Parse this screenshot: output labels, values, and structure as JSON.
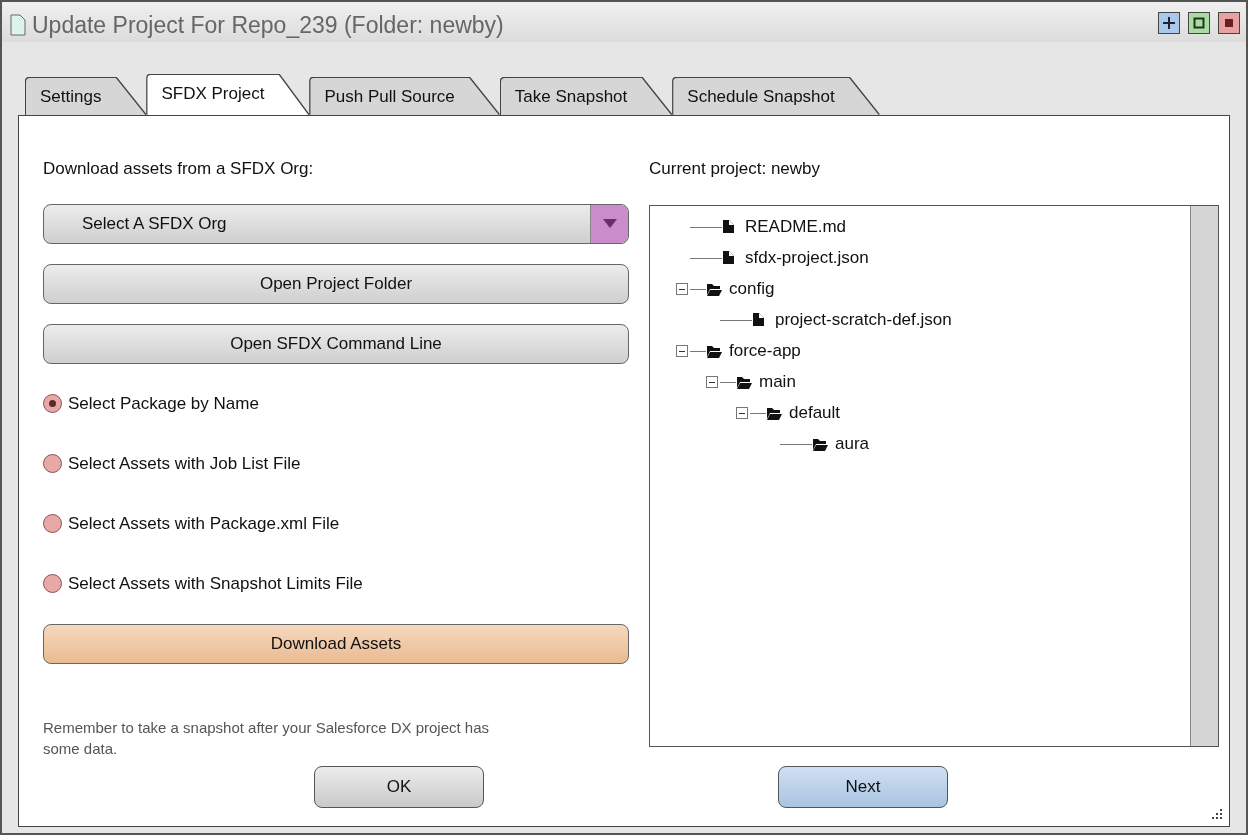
{
  "window": {
    "title": "Update Project For Repo_239 (Folder: newby)"
  },
  "tabs": [
    {
      "label": "Settings",
      "selected": false
    },
    {
      "label": "SFDX Project",
      "selected": true
    },
    {
      "label": "Push Pull Source",
      "selected": false
    },
    {
      "label": "Take Snapshot",
      "selected": false
    },
    {
      "label": "Schedule Snapshot",
      "selected": false
    }
  ],
  "left": {
    "heading": "Download assets from a SFDX Org:",
    "org_select": {
      "value": "Select A SFDX Org"
    },
    "buttons": [
      {
        "label": "Open Project Folder"
      },
      {
        "label": "Open SFDX Command Line"
      }
    ],
    "radios": [
      {
        "label": "Select Package by Name",
        "selected": true
      },
      {
        "label": "Select Assets with Job List File",
        "selected": false
      },
      {
        "label": "Select Assets with Package.xml File",
        "selected": false
      },
      {
        "label": "Select Assets with Snapshot Limits File",
        "selected": false
      }
    ],
    "action": {
      "label": "Download Assets",
      "kind": "primary"
    },
    "note": "Remember to take a snapshot after your Salesforce DX project has some data."
  },
  "right": {
    "heading": "Current project: newby",
    "tree": [
      {
        "label": "README.md",
        "kind": "file"
      },
      {
        "label": "sfdx-project.json",
        "kind": "file"
      },
      {
        "label": "config",
        "kind": "folder",
        "expanded": true,
        "children": [
          {
            "label": "project-scratch-def.json",
            "kind": "file"
          }
        ]
      },
      {
        "label": "force-app",
        "kind": "folder",
        "expanded": true,
        "children": [
          {
            "label": "main",
            "kind": "folder",
            "expanded": true,
            "children": [
              {
                "label": "default",
                "kind": "folder",
                "expanded": true,
                "children": [
                  {
                    "label": "aura",
                    "kind": "folder"
                  }
                ]
              }
            ]
          }
        ]
      }
    ]
  },
  "footer": [
    {
      "label": "OK",
      "kind": "plain"
    },
    {
      "label": "Next",
      "kind": "next"
    }
  ]
}
